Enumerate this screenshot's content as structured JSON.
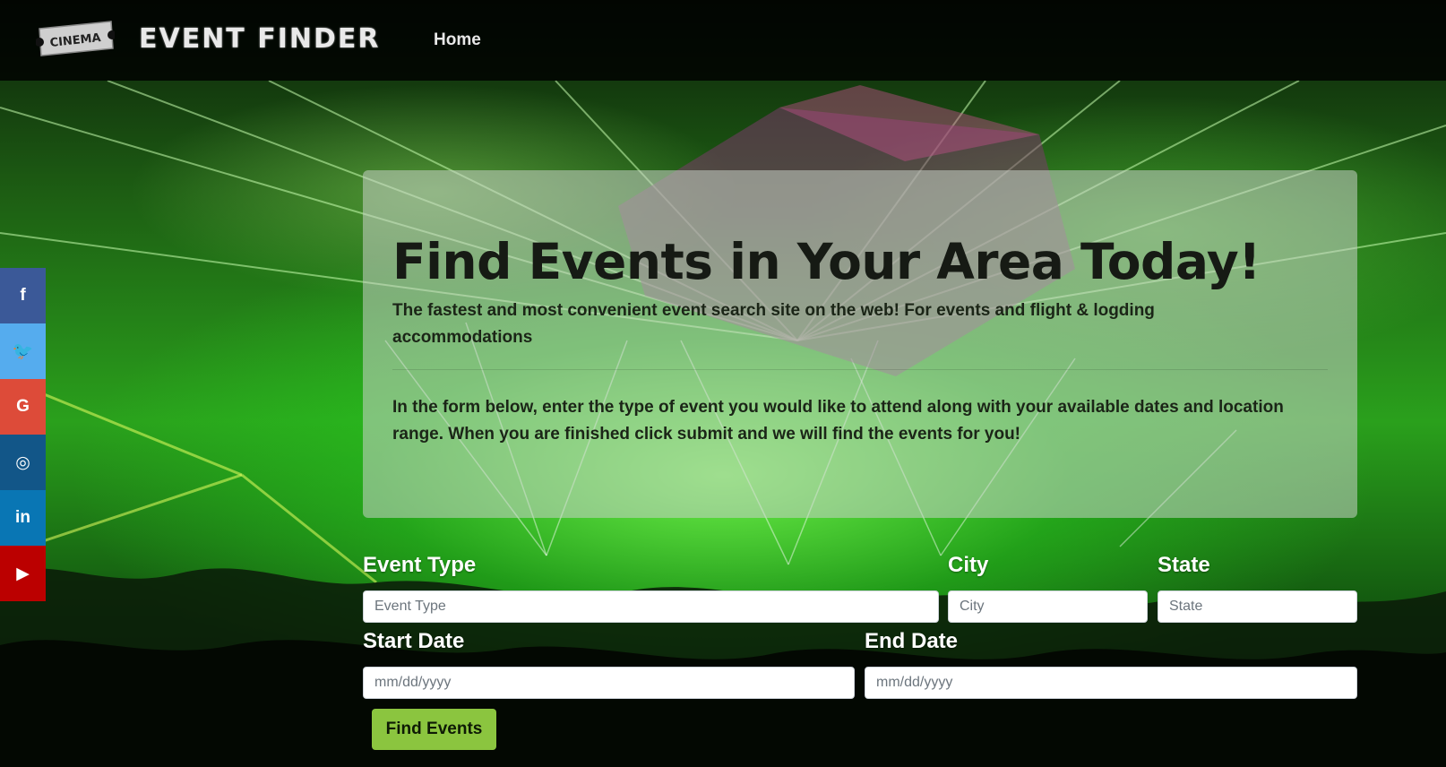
{
  "navbar": {
    "logo_text": "CINEMA",
    "brand": "EVENT FINDER",
    "home_link": "Home"
  },
  "social": [
    {
      "icon": "facebook-icon",
      "glyph": "f",
      "color": "#3b5998"
    },
    {
      "icon": "twitter-icon",
      "glyph": "🐦",
      "color": "#55acee"
    },
    {
      "icon": "google-icon",
      "glyph": "G",
      "color": "#dd4b39"
    },
    {
      "icon": "instagram-icon",
      "glyph": "◎",
      "color": "#125688"
    },
    {
      "icon": "linkedin-icon",
      "glyph": "in",
      "color": "#0976b4"
    },
    {
      "icon": "youtube-icon",
      "glyph": "▶",
      "color": "#bb0000"
    }
  ],
  "hero": {
    "title": "Find Events in Your Area Today!",
    "lead": "The fastest and most convenient event search site on the web! For events and flight & logding accommodations",
    "intro": "In the form below, enter the type of event you would like to attend along with your available dates and location range. When you are finished click submit and we will find the events for you!"
  },
  "form": {
    "event_type_label": "Event Type",
    "event_type_placeholder": "Event Type",
    "city_label": "City",
    "city_placeholder": "City",
    "state_label": "State",
    "state_placeholder": "State",
    "start_date_label": "Start Date",
    "start_date_placeholder": "mm/dd/yyyy",
    "end_date_label": "End Date",
    "end_date_placeholder": "mm/dd/yyyy",
    "submit_label": "Find Events"
  },
  "colors": {
    "submit_button": "#8bc53f",
    "navbar_bg": "#000000"
  }
}
